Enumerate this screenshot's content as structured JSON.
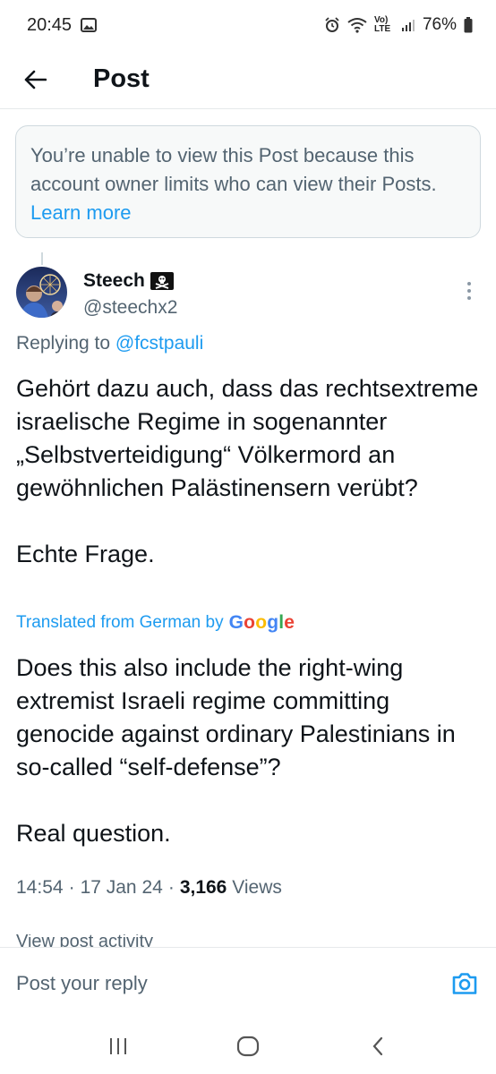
{
  "status_bar": {
    "time": "20:45",
    "network": "Vo) LTE",
    "battery": "76%"
  },
  "header": {
    "title": "Post"
  },
  "notice": {
    "text": "You’re unable to view this Post because this account owner limits who can view their Posts. ",
    "link": "Learn more"
  },
  "post": {
    "display_name": "Steech",
    "flag": "🏴‍☠️",
    "handle": "@steechx2",
    "replying_prefix": "Replying to ",
    "replying_to": "@fcstpauli",
    "text": "Gehört dazu auch, dass das rechtsextreme israelische Regime in sogenannter „Selbstverteidigung“ Völkermord an gewöhnlichen Palästinensern verübt?\n\nEchte Frage.",
    "translated_label": "Translated from German by",
    "translator": "Google",
    "translation": "Does this also include the right-wing extremist Israeli regime committing genocide against ordinary Palestinians in so-called “self-defense”?\n\nReal question.",
    "time": "14:54",
    "date": "17 Jan 24",
    "views_count": "3,166",
    "views_label": "Views",
    "separator": "·",
    "activity": "View post activity"
  },
  "reply": {
    "placeholder": "Post your reply"
  },
  "colors": {
    "accent": "#1d9bf0",
    "secondary_text": "#536471",
    "notice_bg": "#f7f9f9"
  },
  "icons": [
    "back-arrow-icon",
    "more-vertical-icon",
    "camera-icon",
    "pirate-flag-icon",
    "recents-icon",
    "home-icon",
    "back-nav-icon"
  ]
}
